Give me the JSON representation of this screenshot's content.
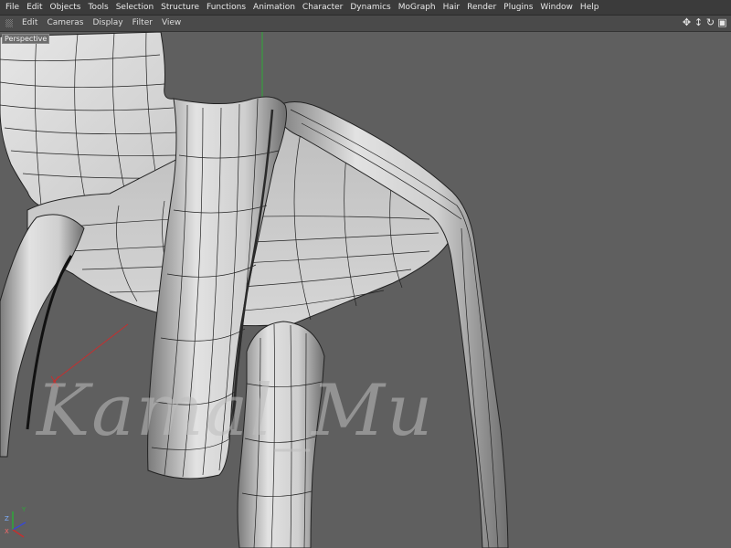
{
  "menu": {
    "items": [
      "File",
      "Edit",
      "Objects",
      "Tools",
      "Selection",
      "Structure",
      "Functions",
      "Animation",
      "Character",
      "Dynamics",
      "MoGraph",
      "Hair",
      "Render",
      "Plugins",
      "Window",
      "Help"
    ]
  },
  "viewport_menu": {
    "items": [
      "Edit",
      "Cameras",
      "Display",
      "Filter",
      "View"
    ],
    "nav_icons": [
      "move-view-icon",
      "zoom-view-icon",
      "rotate-view-icon",
      "maximize-view-icon"
    ]
  },
  "viewport": {
    "label": "Perspective",
    "watermark": "Kamal_Mu",
    "axis_labels": {
      "y": "Y",
      "z": "Z",
      "x": "X"
    }
  },
  "colors": {
    "menubar_bg": "#3b3b3b",
    "viewport_bg": "#5f5f5f",
    "mesh_fill": "#d8d8d8",
    "wire": "#1a1a1a",
    "axis_x": "#c43030",
    "axis_y": "#2fa838",
    "axis_z": "#3a4ad0"
  }
}
